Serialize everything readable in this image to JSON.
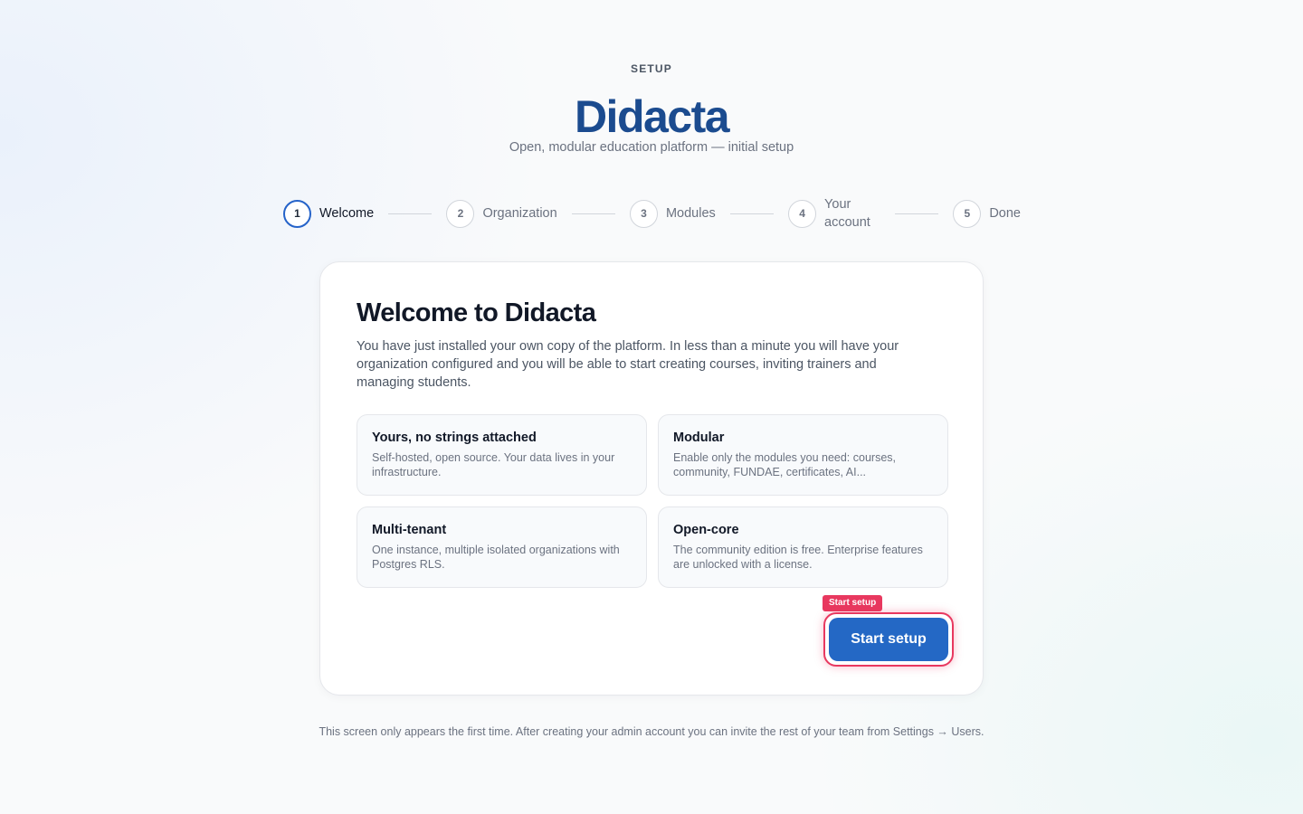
{
  "header": {
    "eyebrow": "SETUP",
    "brand": "Didacta",
    "tagline": "Open, modular education platform — initial setup"
  },
  "stepper": {
    "current_step": 1,
    "steps": [
      {
        "number": "1",
        "label": "Welcome"
      },
      {
        "number": "2",
        "label": "Organization"
      },
      {
        "number": "3",
        "label": "Modules"
      },
      {
        "number": "4",
        "label": "Your account"
      },
      {
        "number": "5",
        "label": "Done"
      }
    ]
  },
  "card": {
    "title": "Welcome to Didacta",
    "intro": "You have just installed your own copy of the platform. In less than a minute you will have your organization configured and you will be able to start creating courses, inviting trainers and managing students.",
    "features": [
      {
        "title": "Yours, no strings attached",
        "desc": "Self-hosted, open source. Your data lives in your infrastructure."
      },
      {
        "title": "Modular",
        "desc": "Enable only the modules you need: courses, community, FUNDAE, certificates, AI..."
      },
      {
        "title": "Multi-tenant",
        "desc": "One instance, multiple isolated organizations with Postgres RLS."
      },
      {
        "title": "Open-core",
        "desc": "The community edition is free. Enterprise features are unlocked with a license."
      }
    ],
    "cta_label": "Start setup",
    "cta_tag": "Start setup"
  },
  "footnote": "This screen only appears the first time. After creating your admin account you can invite the rest of your team from Settings → Users.",
  "colors": {
    "brand": "#1b4b8f",
    "primary_button": "#2468c5",
    "highlight": "#e8385f",
    "active_step_ring": "#2563c9"
  }
}
